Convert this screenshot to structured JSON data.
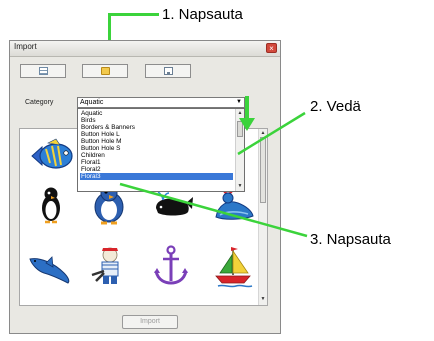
{
  "window": {
    "title": "Import",
    "close_glyph": "×"
  },
  "toolbar": {
    "buttons": [
      {
        "icon": "list-view-icon"
      },
      {
        "icon": "folder-icon"
      },
      {
        "icon": "disk-icon"
      }
    ]
  },
  "category": {
    "label": "Category",
    "selected": "Aquatic",
    "arrow": "▼"
  },
  "dropdown": {
    "items": [
      "Aquatic",
      "Birds",
      "Borders & Banners",
      "Button Hole L",
      "Button Hole M",
      "Button Hole S",
      "Children",
      "Floral1",
      "Floral2",
      "Floral3"
    ],
    "selected_item": "Floral3"
  },
  "grid": {
    "items": [
      "fish",
      "penguin",
      "penguin-large",
      "whale",
      "seal-with-ball",
      "dolphin",
      "sailor-bear",
      "anchor",
      "sailboat"
    ]
  },
  "import_button": {
    "label": "Import",
    "enabled": false
  },
  "callouts": [
    {
      "text": "1. Napsauta"
    },
    {
      "text": "2. Vedä"
    },
    {
      "text": "3. Napsauta"
    }
  ],
  "colors": {
    "callout_line": "#3bd33b",
    "selection": "#3a78d8"
  }
}
